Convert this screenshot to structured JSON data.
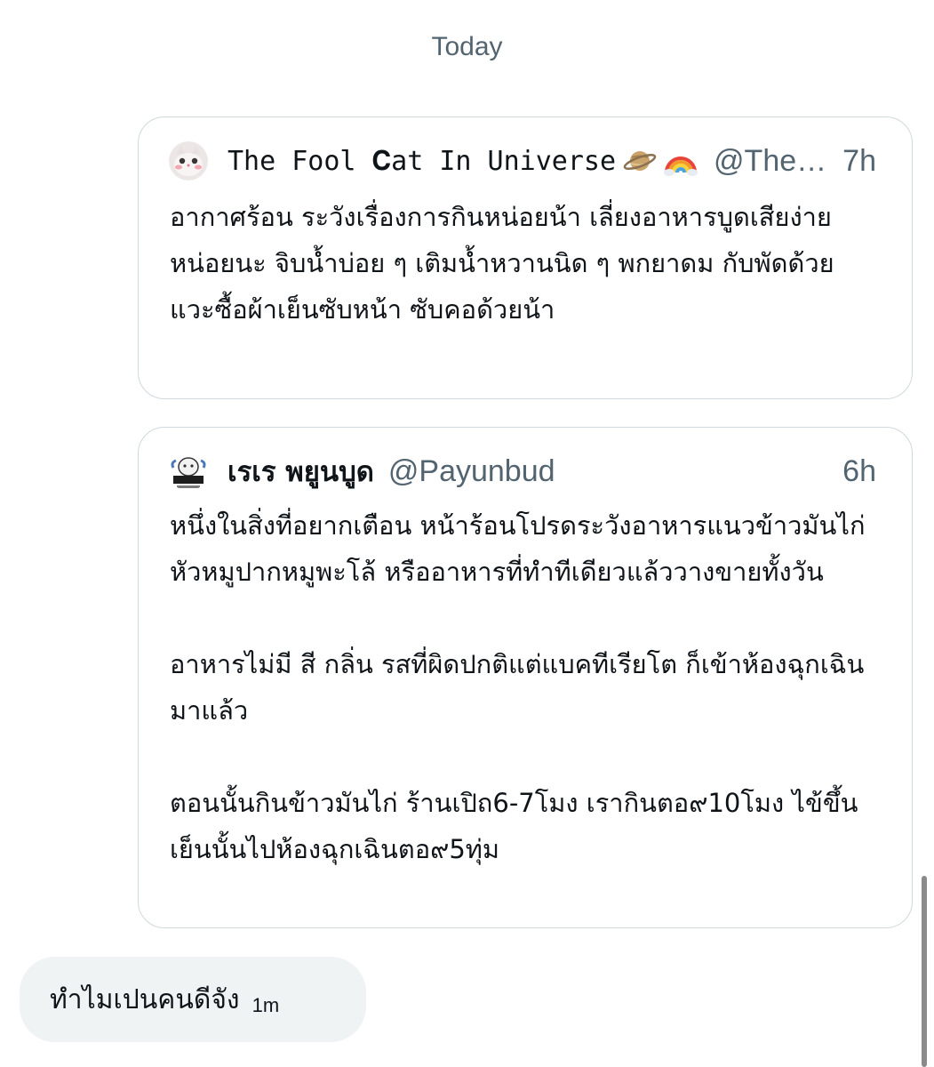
{
  "date_separator": "Today",
  "tweets": [
    {
      "display_name": "The Fool 𝐂at In Universe",
      "emojis": [
        "saturn-icon",
        "rainbow-icon"
      ],
      "handle": "@TheF...",
      "time": "7h",
      "paragraphs": [
        "อากาศร้อน ระวังเรื่องการกินหน่อยน้า เลี่ยงอาหารบูดเสียง่ายหน่อยนะ จิบน้ำบ่อย ๆ เติมน้ำหวานนิด ๆ พกยาดม กับพัดด้วย แวะซื้อผ้าเย็นซับหน้า ซับคอด้วยน้า"
      ]
    },
    {
      "display_name": "เรเร พยูนบูด",
      "handle": "@Payunbud",
      "time": "6h",
      "paragraphs": [
        "หนึ่งในสิ่งที่อยากเตือน หน้าร้อนโปรดระวังอาหารแนวข้าวมันไก่ หัวหมูปากหมูพะโล้ หรืออาหารที่ทำทีเดียวแล้ววางขายทั้งวัน",
        "อาหารไม่มี สี กลิ่น รสที่ผิดปกติแต่แบคทีเรียโต ก็เข้าห้องฉุกเฉินมาแล้ว",
        "ตอนนั้นกินข้าวมันไก่ ร้านเปิถ6-7โมง เรากินตอ๙10โมง ไข้ขึ้นเย็นนั้นไปห้องฉุกเฉินตอ๙5ทุ่ม"
      ]
    }
  ],
  "message": {
    "text": "ทำไมเปนคนดีจัง",
    "time": "1m"
  },
  "colors": {
    "text": "#0f1419",
    "secondary": "#536471",
    "border": "#cfd9de",
    "bubble": "#eff3f4"
  }
}
